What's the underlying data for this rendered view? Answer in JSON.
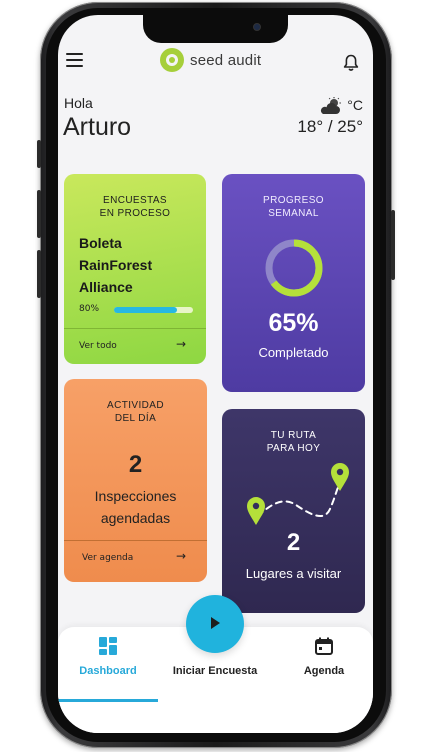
{
  "header": {
    "brand": "seed audit"
  },
  "greeting": {
    "hello": "Hola",
    "name": "Arturo"
  },
  "weather": {
    "unit": "°C",
    "temperature": "18° / 25°",
    "icon": "partly-cloudy-icon"
  },
  "cards": {
    "encuestas": {
      "title_line1": "ENCUESTAS",
      "title_line2": "EN PROCESO",
      "project_line1": "Boleta",
      "project_line2": "RainForest",
      "project_line3": "Alliance",
      "progress_label": "80%",
      "progress_value": 0.8,
      "link": "Ver todo"
    },
    "progreso": {
      "title_line1": "PROGRESO",
      "title_line2": "SEMANAL",
      "percent": "65%",
      "percent_value": 0.65,
      "subtitle": "Completado"
    },
    "actividad": {
      "title_line1": "ACTIVIDAD",
      "title_line2": "DEL DÍA",
      "count": "2",
      "label": "Inspecciones agendadas",
      "link": "Ver agenda"
    },
    "ruta": {
      "title_line1": "TU RUTA",
      "title_line2": "PARA HOY",
      "count": "2",
      "label": "Lugares a visitar"
    }
  },
  "tabs": [
    {
      "label": "Dashboard",
      "icon": "dashboard-icon",
      "active": true
    },
    {
      "label": "Iniciar Encuesta",
      "icon": "play-icon",
      "active": false
    },
    {
      "label": "Agenda",
      "icon": "calendar-icon",
      "active": false
    }
  ],
  "colors": {
    "accent_blue": "#27a9d9",
    "green_card": "#a6dc4a",
    "purple_card": "#5c47b5",
    "orange_card": "#f39256",
    "dark_card": "#342d5d",
    "lime": "#b5e03a"
  }
}
